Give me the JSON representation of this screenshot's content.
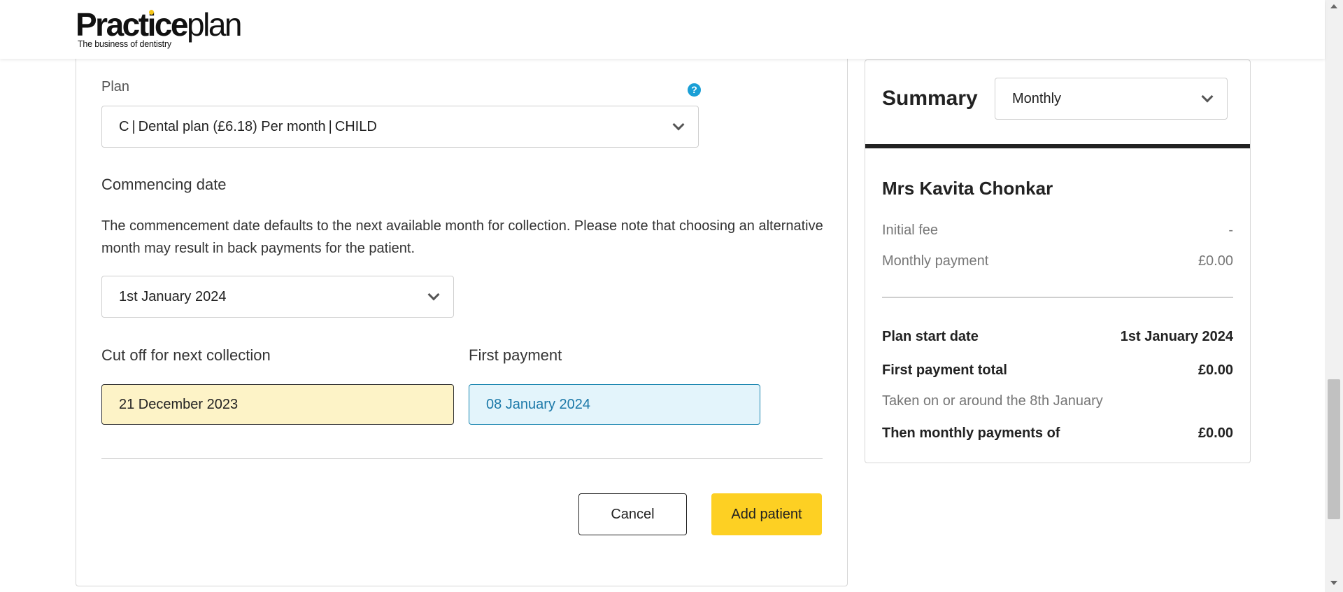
{
  "header": {
    "logo_bold": "Practice",
    "logo_light": "plan",
    "logo_tagline": "The business of dentistry"
  },
  "form": {
    "plan_label": "Plan",
    "help_icon_glyph": "?",
    "plan_value": "C | Dental plan (£6.18) Per month | CHILD",
    "commencing_label": "Commencing date",
    "commencing_description": "The commencement date defaults to the next available month for collection. Please note that choosing an alternative month may result in back payments for the patient.",
    "commencing_value": "1st January 2024",
    "cutoff_label": "Cut off for next collection",
    "cutoff_value": "21 December 2023",
    "first_payment_label": "First payment",
    "first_payment_value": "08 January 2024",
    "cancel_label": "Cancel",
    "add_label": "Add patient"
  },
  "summary": {
    "title": "Summary",
    "frequency_value": "Monthly",
    "patient_name": "Mrs Kavita Chonkar",
    "rows": {
      "initial_fee_label": "Initial fee",
      "initial_fee_value": "-",
      "monthly_payment_label": "Monthly payment",
      "monthly_payment_value": "£0.00",
      "plan_start_label": "Plan start date",
      "plan_start_value": "1st January 2024",
      "first_total_label": "First payment total",
      "first_total_value": "£0.00",
      "taken_on_note": "Taken on or around the 8th January",
      "then_monthly_label": "Then monthly payments of",
      "then_monthly_value": "£0.00"
    }
  },
  "colors": {
    "accent_yellow": "#fdd023",
    "cutoff_bg": "#fdf3c7",
    "first_payment_bg": "#e3f4fb",
    "help_blue": "#1a9fd6"
  },
  "icons": {
    "help": "help-icon",
    "dropdown": "chevron-down-icon"
  }
}
